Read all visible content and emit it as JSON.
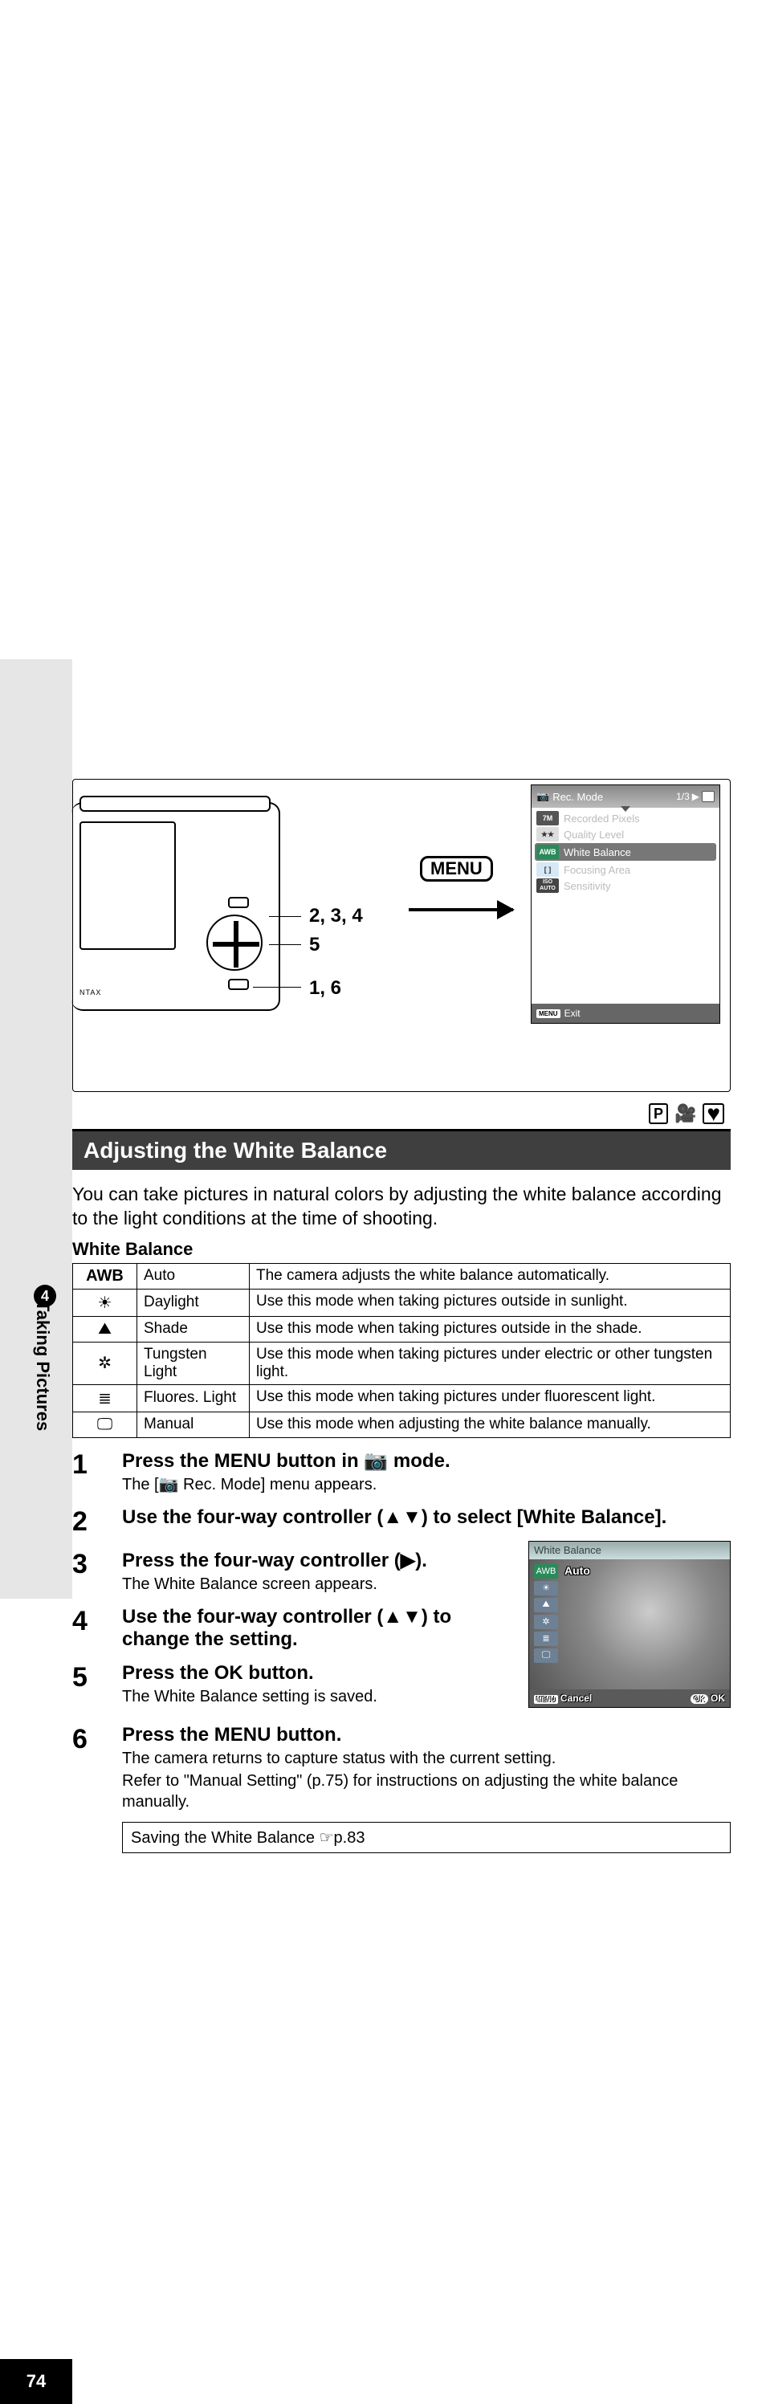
{
  "page": {
    "number": "74",
    "section_number": "4",
    "section_title": "Taking Pictures"
  },
  "diagram": {
    "menu_label": "MENU",
    "labels": {
      "l1": "2, 3, 4",
      "l2": "5",
      "l3": "1, 6"
    },
    "camera_brand": "NTAX"
  },
  "lcd": {
    "title": "Rec. Mode",
    "pager": "1/3",
    "rows": [
      {
        "chip": "7M",
        "label": "Recorded Pixels"
      },
      {
        "chip": "★★",
        "label": "Quality Level"
      },
      {
        "chip": "AWB",
        "label": "White Balance"
      },
      {
        "chip": "[ ]",
        "label": "Focusing Area"
      },
      {
        "chip": "ISO AUTO",
        "label": "Sensitivity"
      }
    ],
    "footer_chip": "MENU",
    "footer_text": "Exit"
  },
  "mode_icons": {
    "p": "P"
  },
  "title": "Adjusting the White Balance",
  "intro": "You can take pictures in natural colors by adjusting the white balance according to the light conditions at the time of shooting.",
  "table_title": "White Balance",
  "wb_table": [
    {
      "sym": "AWB",
      "name": "Auto",
      "desc": "The camera adjusts the white balance automatically."
    },
    {
      "sym": "☀",
      "name": "Daylight",
      "desc": "Use this mode when taking pictures outside in sunlight."
    },
    {
      "sym": "⛰",
      "name": "Shade",
      "desc": "Use this mode when taking pictures outside in the shade."
    },
    {
      "sym": "✲",
      "name": "Tungsten Light",
      "desc": "Use this mode when taking pictures under electric or other tungsten light."
    },
    {
      "sym": "≣",
      "name": "Fluores. Light",
      "desc": "Use this mode when taking pictures under fluorescent light."
    },
    {
      "sym": "🖵",
      "name": "Manual",
      "desc": "Use this mode when adjusting the white balance manually."
    }
  ],
  "steps": {
    "s1": {
      "num": "1",
      "inst_a": "Press the ",
      "inst_menu": "MENU",
      "inst_b": " button in ",
      "inst_c": " mode.",
      "sub": "The [📷 Rec. Mode] menu appears."
    },
    "s2": {
      "num": "2",
      "inst": "Use the four-way controller (▲▼) to select [White Balance]."
    },
    "s3": {
      "num": "3",
      "inst": "Press the four-way controller (▶).",
      "sub": "The White Balance screen appears."
    },
    "s4": {
      "num": "4",
      "inst": "Use the four-way controller (▲▼) to change the setting."
    },
    "s5": {
      "num": "5",
      "inst_a": "Press the ",
      "inst_ok": "OK",
      "inst_b": " button.",
      "sub": "The White Balance setting is saved."
    },
    "s6": {
      "num": "6",
      "inst_a": "Press the ",
      "inst_menu": "MENU",
      "inst_b": " button.",
      "sub1": "The camera returns to capture status with the current setting.",
      "sub2": "Refer to \"Manual Setting\" (p.75) for instructions on adjusting the white balance manually."
    }
  },
  "wbscreen": {
    "title": "White Balance",
    "auto": "Auto",
    "awb": "AWB",
    "cancel_chip": "MENU",
    "cancel": "Cancel",
    "ok_chip": "OK",
    "ok": "OK"
  },
  "note": "Saving the White Balance ☞p.83"
}
